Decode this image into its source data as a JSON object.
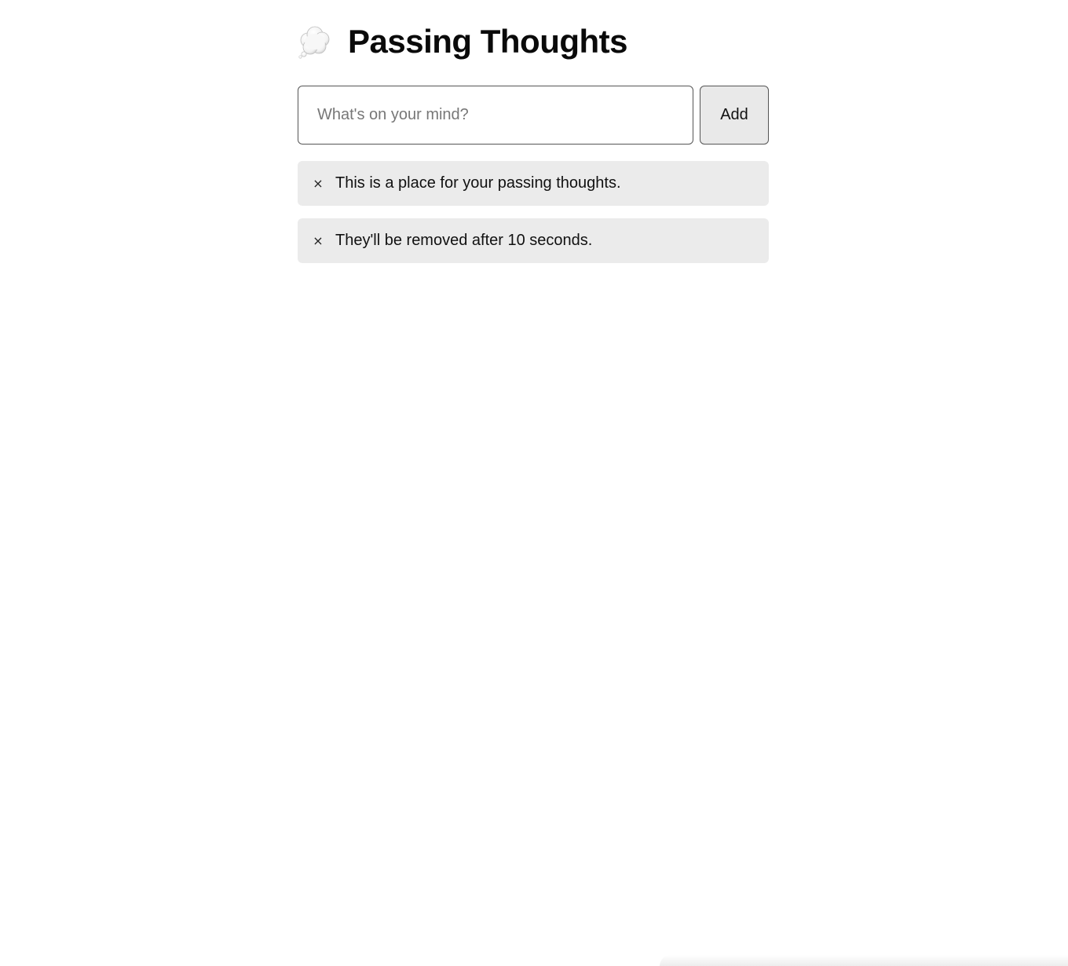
{
  "header": {
    "icon": "thought-balloon-icon",
    "title": "Passing Thoughts"
  },
  "form": {
    "input_placeholder": "What's on your mind?",
    "input_value": "",
    "add_label": "Add"
  },
  "thoughts": [
    {
      "remove_label": "×",
      "text": "This is a place for your passing thoughts."
    },
    {
      "remove_label": "×",
      "text": "They'll be removed after 10 seconds."
    }
  ]
}
